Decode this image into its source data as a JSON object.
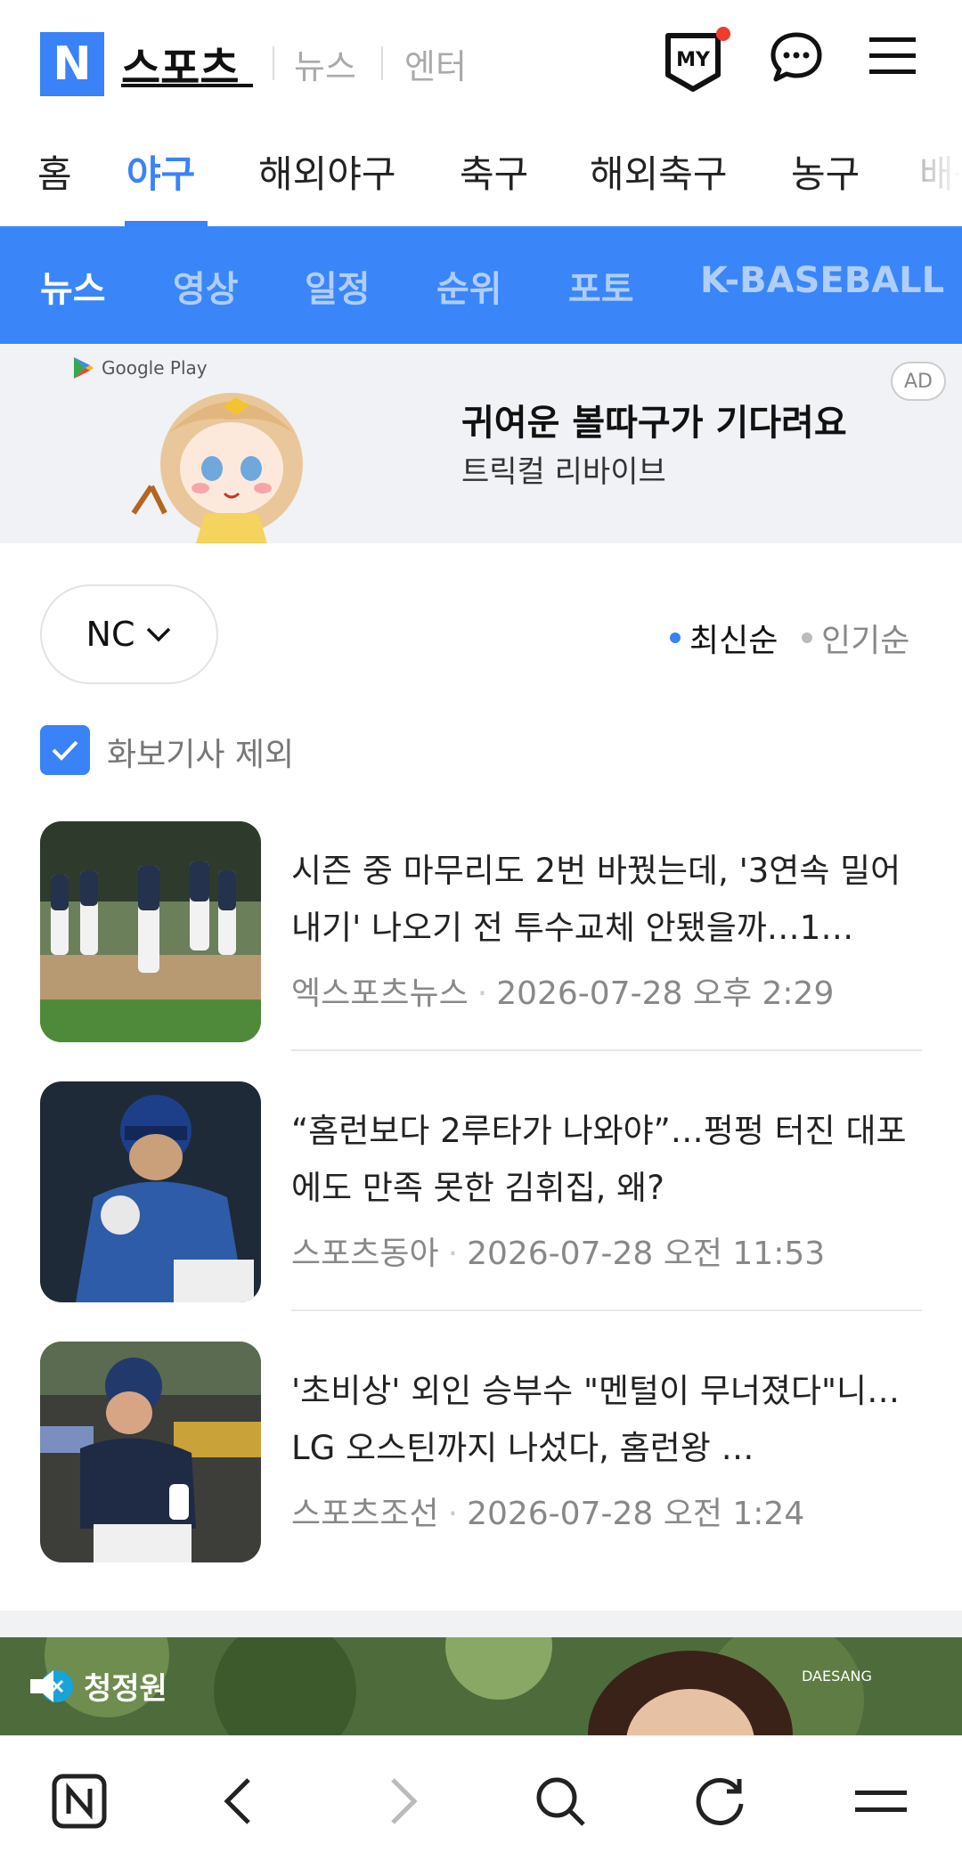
{
  "header": {
    "logo_letter": "N",
    "brand": "스포츠",
    "links": [
      "뉴스",
      "엔터"
    ],
    "my_label": "MY"
  },
  "category_tabs": [
    "홈",
    "야구",
    "해외야구",
    "축구",
    "해외축구",
    "농구",
    "배구"
  ],
  "category_active": "야구",
  "sub_tabs": [
    "뉴스",
    "영상",
    "일정",
    "순위",
    "포토",
    "K-BASEBALL"
  ],
  "sub_active": "뉴스",
  "ad": {
    "store": "Google Play",
    "title": "귀여운 볼따구가 기다려요",
    "subtitle": "트릭컬 리바이브",
    "badge": "AD"
  },
  "filter": {
    "team": "NC",
    "sort_options": [
      "최신순",
      "인기순"
    ],
    "sort_active": "최신순",
    "checkbox_label": "화보기사 제외",
    "checkbox_checked": true
  },
  "articles": [
    {
      "title": "시즌 중 마무리도 2번 바꿨는데, '3연속 밀어내기' 나오기 전 투수교체 안됐을까…1…",
      "source": "엑스포츠뉴스",
      "date": "2026-07-28 오후 2:29"
    },
    {
      "title": "“홈런보다 2루타가 나와야”…펑펑 터진 대포에도 만족 못한 김휘집, 왜?",
      "source": "스포츠동아",
      "date": "2026-07-28 오전 11:53"
    },
    {
      "title": "'초비상' 외인 승부수 \"멘털이 무너졌다\"니…LG 오스틴까지 나섰다, 홈런왕 …",
      "source": "스포츠조선",
      "date": "2026-07-28 오전 1:24"
    }
  ],
  "banner": {
    "brand": "청정원",
    "partner": "DAESANG"
  },
  "colors": {
    "accent": "#3a82f7",
    "subnav": "#3a86f8"
  }
}
